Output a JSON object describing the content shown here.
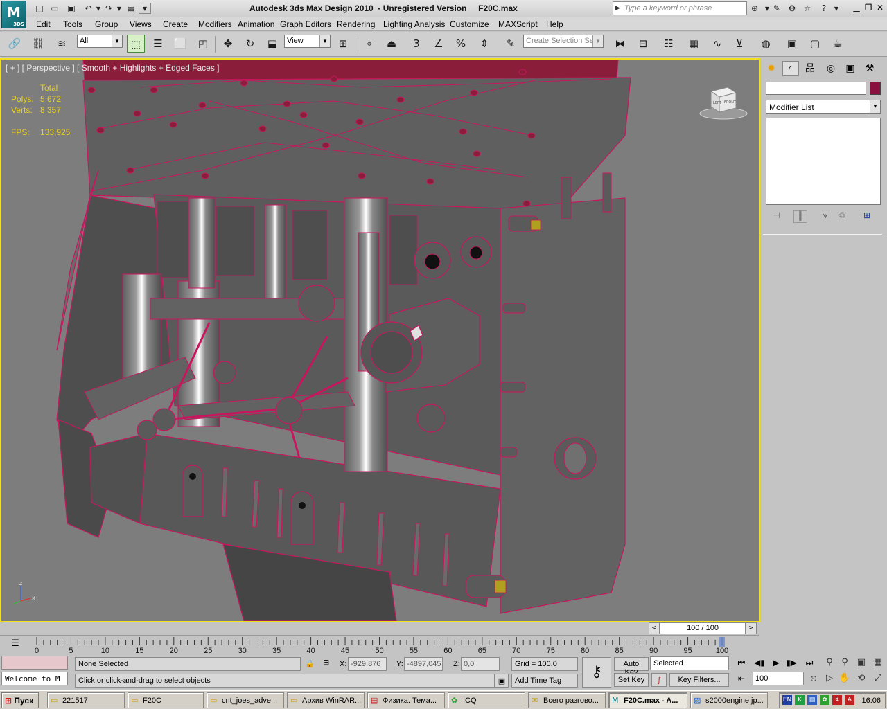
{
  "window": {
    "title": "Autodesk 3ds Max Design 2010  - Unregistered Version     F20C.max",
    "logo_text": "3DS",
    "search_placeholder": "Type a keyword or phrase"
  },
  "menu": [
    "Edit",
    "Tools",
    "Group",
    "Views",
    "Create",
    "Modifiers",
    "Animation",
    "Graph Editors",
    "Rendering",
    "Lighting Analysis",
    "Customize",
    "MAXScript",
    "Help"
  ],
  "toolbar": {
    "selection_filter": "All",
    "reference_coord": "View",
    "snap_label": "3",
    "named_selection_placeholder": "Create Selection Se"
  },
  "viewport": {
    "label": "[ + ] [ Perspective ] [ Smooth + Highlights + Edged Faces ]",
    "stats": {
      "header": "Total",
      "polys_label": "Polys:",
      "polys_value": "5 672",
      "verts_label": "Verts:",
      "verts_value": "8 357",
      "fps_label": "FPS:",
      "fps_value": "133,925"
    },
    "viewcube": {
      "left": "LEFT",
      "front": "FRONT"
    },
    "axis": {
      "z": "z",
      "x": "x"
    }
  },
  "command_panel": {
    "modifier_list": "Modifier List",
    "object_color": "#8a1040"
  },
  "time": {
    "slider_text": "100 / 100",
    "ticks": [
      "0",
      "5",
      "10",
      "15",
      "20",
      "25",
      "30",
      "35",
      "40",
      "45",
      "50",
      "55",
      "60",
      "65",
      "70",
      "75",
      "80",
      "85",
      "90",
      "95",
      "100"
    ],
    "current_frame": 100,
    "total_frames": 100
  },
  "status": {
    "maxscript_listener": "",
    "listener_text": "Welcome to M",
    "selection_info": "None Selected",
    "prompt": "Click or click-and-drag to select objects",
    "x_label": "X:",
    "x_value": "-929,876",
    "y_label": "Y:",
    "y_value": "-4897,045",
    "z_label": "Z:",
    "z_value": "0,0",
    "grid": "Grid = 100,0",
    "add_time_tag": "Add Time Tag",
    "auto_key": "Auto Key",
    "set_key": "Set Key",
    "key_mode": "Selected",
    "key_filters": "Key Filters...",
    "frame_value": "100"
  },
  "taskbar": {
    "start": "Пуск",
    "tasks": [
      {
        "label": "221517",
        "icon": "folder-icon"
      },
      {
        "label": "F20C",
        "icon": "folder-icon"
      },
      {
        "label": "cnt_joes_adve...",
        "icon": "folder-icon"
      },
      {
        "label": "Архив WinRAR...",
        "icon": "folder-icon"
      },
      {
        "label": "Физика. Тема...",
        "icon": "pdf-icon"
      },
      {
        "label": "ICQ",
        "icon": "icq-icon"
      },
      {
        "label": "Всего разгово...",
        "icon": "chat-icon"
      },
      {
        "label": "F20C.max - A...",
        "icon": "max-icon",
        "active": true
      },
      {
        "label": "s2000engine.jp...",
        "icon": "image-icon"
      }
    ],
    "lang": "EN",
    "clock": "16:06"
  },
  "colors": {
    "viewport_bg": "#7d7d7d",
    "wire": "#c8165e",
    "model": "#5a5a5a",
    "active_border": "#f0e020"
  }
}
